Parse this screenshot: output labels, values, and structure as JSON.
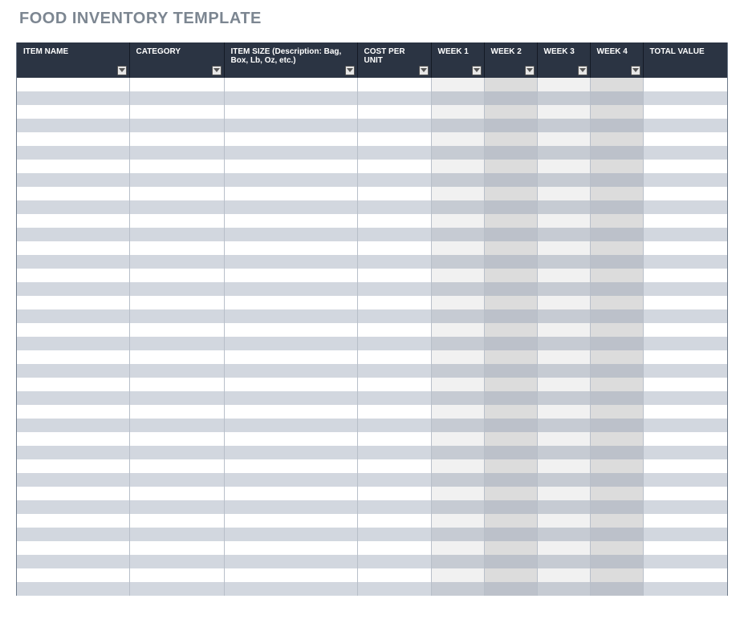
{
  "title": "FOOD INVENTORY  TEMPLATE",
  "columns": [
    {
      "key": "item_name",
      "label": "ITEM NAME"
    },
    {
      "key": "category",
      "label": "CATEGORY"
    },
    {
      "key": "item_size",
      "label": "ITEM SIZE (Description: Bag, Box, Lb, Oz, etc.)"
    },
    {
      "key": "cost",
      "label": "COST PER UNIT"
    },
    {
      "key": "week1",
      "label": "WEEK 1"
    },
    {
      "key": "week2",
      "label": "WEEK 2"
    },
    {
      "key": "week3",
      "label": "WEEK 3"
    },
    {
      "key": "week4",
      "label": "WEEK 4"
    },
    {
      "key": "total",
      "label": "TOTAL VALUE"
    }
  ],
  "row_count": 38,
  "colors": {
    "header_bg": "#2b3443",
    "header_fg": "#ffffff",
    "stripe_odd": "#ffffff",
    "stripe_even": "#d2d7df",
    "title_color": "#7c8691"
  }
}
